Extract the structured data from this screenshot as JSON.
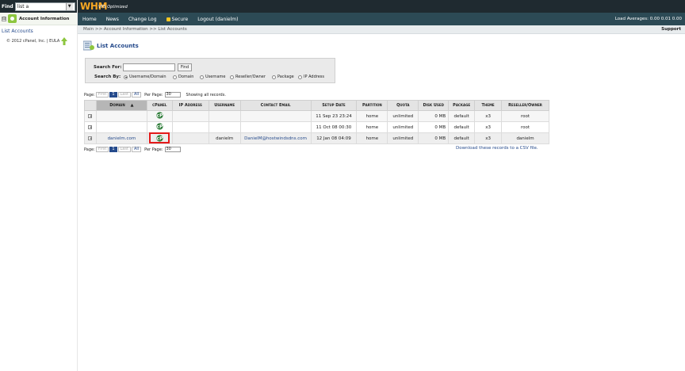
{
  "sidebar": {
    "find_label": "Find",
    "find_value": "list a",
    "group_label": "Account Information",
    "group_expander": "⊟",
    "item_label": "List Accounts",
    "copyright": "© 2012 cPanel, Inc. | EULA"
  },
  "header": {
    "logo": "WHM",
    "logo_sub": "VPS Optimized",
    "nav": [
      "Home",
      "News",
      "Change Log",
      "Secure",
      "Logout (danielm)"
    ],
    "load_avg": "Load Averages: 0.00 0.01 0.00"
  },
  "crumb": {
    "text": "Main >> Account Information >> List Accounts",
    "support": "Support"
  },
  "page": {
    "title": "List Accounts"
  },
  "search": {
    "search_for_label": "Search For:",
    "find_button": "Find",
    "search_by_label": "Search By:",
    "options": [
      "Username/Domain",
      "Domain",
      "Username",
      "Reseller/Owner",
      "Package",
      "IP Address"
    ],
    "selected": "Username/Domain"
  },
  "pager": {
    "page_label": "Page:",
    "first": "First",
    "current": "1",
    "last": "Last",
    "all": "All",
    "per_page_label": "Per Page:",
    "per_page": "30",
    "showing": "Showing all records."
  },
  "table": {
    "headers": [
      "",
      "Domain",
      "cPanel",
      "IP Address",
      "Username",
      "Contact Email",
      "Setup Date",
      "Partition",
      "Quota",
      "Disk Used",
      "Package",
      "Theme",
      "Reseller/Owner"
    ],
    "sort_arrow": "▲",
    "rows": [
      {
        "domain": "",
        "ip": "",
        "username": "",
        "email": "",
        "setup": "11 Sep 23 23:24",
        "partition": "home",
        "quota": "unlimited",
        "disk": "0 MB",
        "package": "default",
        "theme": "x3",
        "owner": "root"
      },
      {
        "domain": "",
        "ip": "",
        "username": "",
        "email": "",
        "setup": "11 Oct 08 00:30",
        "partition": "home",
        "quota": "unlimited",
        "disk": "0 MB",
        "package": "default",
        "theme": "x3",
        "owner": "root"
      },
      {
        "domain": "danielm.com",
        "ip": "",
        "username": "danielm",
        "email": "DanielM@hostwindsdns.com",
        "setup": "12 Jan 08 04:09",
        "partition": "home",
        "quota": "unlimited",
        "disk": "0 MB",
        "package": "default",
        "theme": "x3",
        "owner": "danielm"
      }
    ]
  },
  "csv_link": "Download these records to a CSV file.",
  "colors": {
    "header_bg": "#1f2a30",
    "nav_bg": "#2c4a55",
    "logo": "#f5a623",
    "link": "#264b8c",
    "highlight": "#e41a1a"
  },
  "icons": {
    "cpanel": "cpanel-icon",
    "title": "list-accounts-icon",
    "expand": "expand-icon"
  }
}
